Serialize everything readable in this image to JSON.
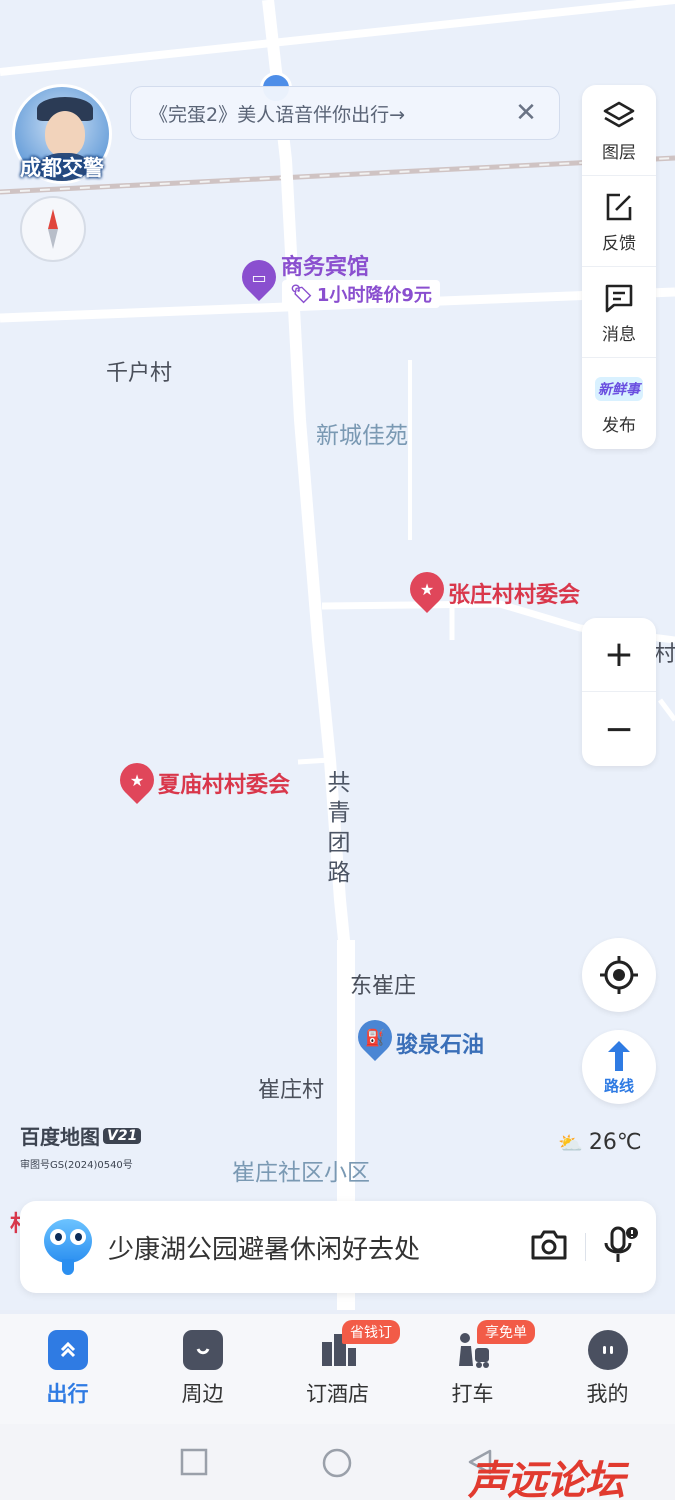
{
  "map": {
    "labels": {
      "qianhu": "千户村",
      "xincheng": "新城佳苑",
      "dongcui": "东崔庄",
      "cuizhuang": "崔庄村",
      "cuizhuang_community": "崔庄社区小区",
      "road": [
        "共",
        "青",
        "团",
        "路"
      ],
      "edge_right": "村",
      "edge_left": "村"
    },
    "pois": {
      "hotel": "商务宾馆",
      "hotel_promo": "1小时降价9元",
      "zhangzhuang": "张庄村村委会",
      "xiamiao": "夏庙村村委会",
      "gas": "骏泉石油"
    }
  },
  "avatar": {
    "badge": "成都交警"
  },
  "notice": {
    "text": "《完蛋2》美人语音伴你出行→",
    "close": "✕"
  },
  "toolbox": {
    "layers": "图层",
    "feedback": "反馈",
    "messages": "消息",
    "publish": "发布",
    "publish_badge": "新鲜事"
  },
  "zoom": {
    "in": "+",
    "out": "−"
  },
  "route": {
    "label": "路线"
  },
  "logo": {
    "brand": "百度地图",
    "version": "V21",
    "review": "审图号GS(2024)0540号"
  },
  "weather": {
    "temp": "26℃"
  },
  "search": {
    "placeholder": "少康湖公园避暑休闲好去处"
  },
  "tabs": [
    {
      "label": "出行",
      "badge": ""
    },
    {
      "label": "周边",
      "badge": ""
    },
    {
      "label": "订酒店",
      "badge": "省钱订"
    },
    {
      "label": "打车",
      "badge": "享免单"
    },
    {
      "label": "我的",
      "badge": ""
    }
  ],
  "watermark": "声远论坛",
  "colors": {
    "accent": "#2f7be3",
    "poi_red": "#d9374b",
    "poi_purple": "#8a4fcf",
    "badge": "#f25b47"
  }
}
